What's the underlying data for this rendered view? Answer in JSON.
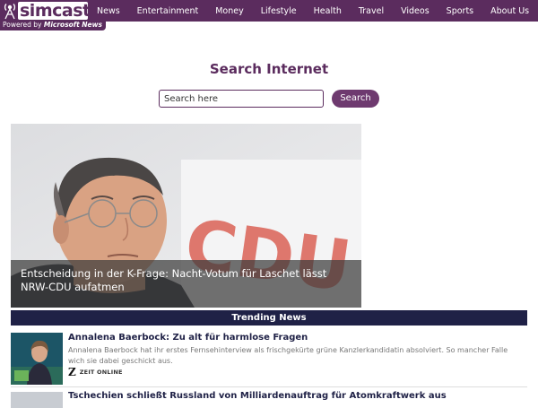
{
  "brand": {
    "name": "simcast",
    "powered_prefix": "Powered by ",
    "powered_brand": "Microsoft News",
    "color": "#5b2c5e"
  },
  "nav": {
    "items": [
      "News",
      "Entertainment",
      "Money",
      "Lifestyle",
      "Health",
      "Travel",
      "Videos",
      "Sports",
      "About Us"
    ]
  },
  "search": {
    "title": "Search Internet",
    "placeholder": "Search here",
    "button_label": "Search"
  },
  "hero": {
    "caption": "Entscheidung in der K-Frage: Nacht-Votum für Laschet lässt NRW-CDU aufatmen",
    "background_letters": "CDU"
  },
  "trending": {
    "heading": "Trending News",
    "color": "#1f2146",
    "items": [
      {
        "title": "Annalena Baerbock: Zu alt für harmlose Fragen",
        "description": "Annalena Baerbock hat ihr erstes Fernsehinterview als frischgekürte grüne Kanzlerkandidatin absolviert. So mancher Falle wich sie dabei geschickt aus.",
        "source_logo": "Z",
        "source_name": "ZEIT ONLINE"
      },
      {
        "title": "Tschechien schließt Russland von Milliardenauftrag für Atomkraftwerk aus"
      }
    ]
  },
  "icons": {
    "logo": "broadcast-tower-icon"
  }
}
